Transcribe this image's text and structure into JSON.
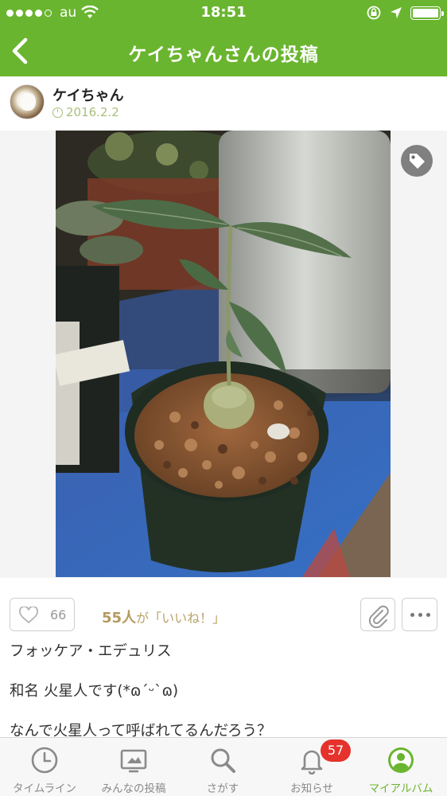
{
  "status_bar": {
    "carrier": "au",
    "time": "18:51",
    "signal_bars_filled": 4,
    "signal_bars_total": 5,
    "battery_level": 1.0,
    "icons": [
      "wifi-icon",
      "rotation-lock-icon",
      "location-arrow-icon",
      "battery-icon"
    ]
  },
  "nav": {
    "title": "ケイちゃんさんの投稿",
    "back_icon": "chevron-left-icon",
    "accent_color": "#6ab52f"
  },
  "author": {
    "name": "ケイちゃん",
    "date": "2016.2.2"
  },
  "photo": {
    "alt": "plant photo",
    "tag_icon": "tag-icon"
  },
  "actions": {
    "like_count": "66",
    "likes_people": "55人",
    "likes_suffix": "が「いいね！」",
    "clip_icon": "paperclip-icon",
    "more_icon": "more-dots-icon"
  },
  "post": {
    "lines": [
      "フォッケア・エデュリス",
      "和名  火星人です(*ɷ´ᵕ`ɷ)",
      "なんで火星人って呼ばれてるんだろう？"
    ]
  },
  "tabbar": {
    "tabs": [
      {
        "label": "タイムライン",
        "icon": "clock-icon",
        "active": false
      },
      {
        "label": "みんなの投稿",
        "icon": "photo-frame-icon",
        "active": false
      },
      {
        "label": "さがす",
        "icon": "search-icon",
        "active": false
      },
      {
        "label": "お知らせ",
        "icon": "bell-icon",
        "active": false
      },
      {
        "label": "マイアルバム",
        "icon": "user-circle-icon",
        "active": true
      }
    ],
    "notification_badge": "57"
  }
}
